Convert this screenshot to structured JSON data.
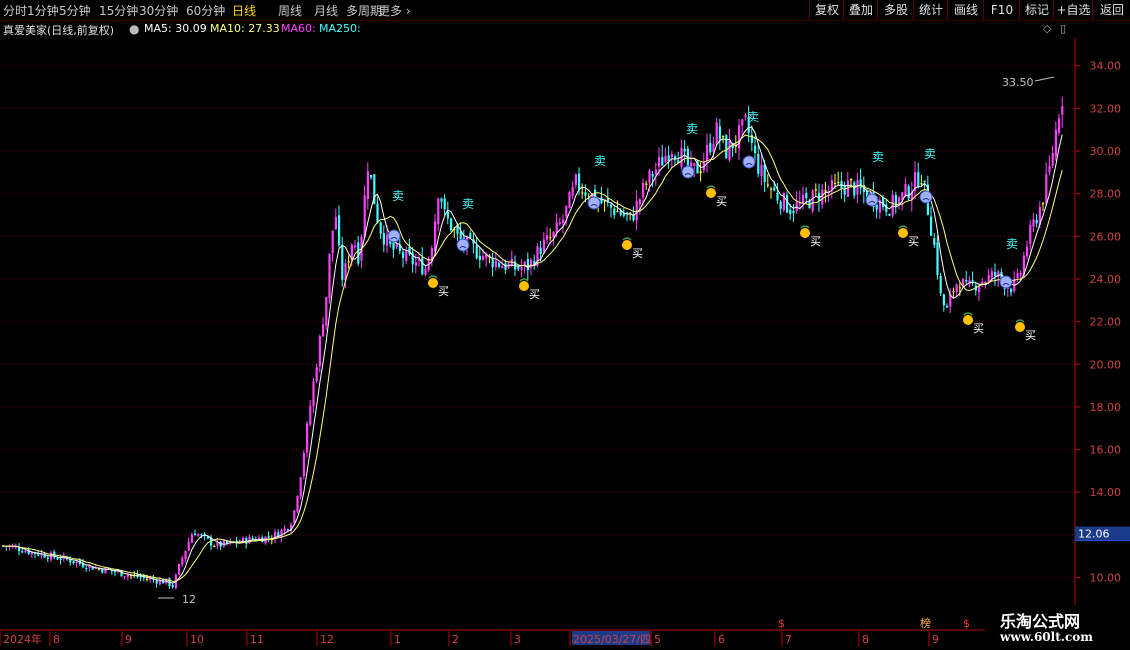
{
  "toolbar": {
    "periods": [
      "分时",
      "1分钟",
      "5分钟",
      "15分钟",
      "30分钟",
      "60分钟",
      "日线",
      "周线",
      "月线",
      "多周期",
      "更多"
    ],
    "active_index": 6,
    "right_buttons": [
      "复权",
      "叠加",
      "多股",
      "统计",
      "画线",
      "F10",
      "标记",
      "+自选",
      "返回"
    ]
  },
  "info": {
    "stock": "真爱美家(日线,前复权)",
    "ma5": "MA5: 30.09",
    "ma10": "MA10: 27.33",
    "ma60": "MA60:",
    "ma250": "MA250:"
  },
  "colors": {
    "up": "#ff40ff",
    "down": "#40ffff",
    "flat": "#ffff40",
    "ma5": "#ffffff",
    "ma10": "#ffff80",
    "grid": "#5a0000",
    "axis": "#c00000"
  },
  "chart_data": {
    "type": "candlestick",
    "ylim": [
      9.2,
      35.0
    ],
    "y_ticks": [
      10,
      12,
      14,
      16,
      18,
      20,
      22,
      24,
      26,
      28,
      30,
      32,
      34
    ],
    "y_tick_labels": [
      "10.00",
      "12.00",
      "14.00",
      "16.00",
      "18.00",
      "20.00",
      "22.00",
      "24.00",
      "26.00",
      "28.00",
      "30.00",
      "32.00",
      "34.00"
    ],
    "x_labels": [
      "2024年",
      "8",
      "9",
      "10",
      "11",
      "12",
      "1",
      "2",
      "3",
      "2025/03/27/四",
      "5",
      "6",
      "7",
      "8",
      "9"
    ],
    "last_price": "12.06",
    "price_path": [
      [
        0,
        11.5
      ],
      [
        15,
        11.4
      ],
      [
        30,
        11.2
      ],
      [
        50,
        11.0
      ],
      [
        70,
        10.8
      ],
      [
        90,
        10.5
      ],
      [
        110,
        10.3
      ],
      [
        130,
        10.1
      ],
      [
        150,
        9.9
      ],
      [
        165,
        9.8
      ],
      [
        172,
        9.6
      ],
      [
        176,
        10.2
      ],
      [
        180,
        10.8
      ],
      [
        186,
        11.5
      ],
      [
        192,
        12.2
      ],
      [
        200,
        11.9
      ],
      [
        215,
        11.5
      ],
      [
        230,
        11.6
      ],
      [
        250,
        11.8
      ],
      [
        270,
        11.9
      ],
      [
        285,
        12.3
      ],
      [
        292,
        12.8
      ],
      [
        300,
        15.0
      ],
      [
        306,
        17.0
      ],
      [
        312,
        19.0
      ],
      [
        320,
        21.5
      ],
      [
        326,
        23.5
      ],
      [
        330,
        26.0
      ],
      [
        335,
        27.0
      ],
      [
        340,
        24.0
      ],
      [
        345,
        24.5
      ],
      [
        352,
        26.0
      ],
      [
        358,
        25.0
      ],
      [
        362,
        27.0
      ],
      [
        367,
        29.5
      ],
      [
        372,
        28.0
      ],
      [
        378,
        26.5
      ],
      [
        388,
        25.5
      ],
      [
        398,
        25.2
      ],
      [
        412,
        24.8
      ],
      [
        425,
        24.5
      ],
      [
        432,
        26.0
      ],
      [
        438,
        28.5
      ],
      [
        443,
        27.0
      ],
      [
        450,
        26.5
      ],
      [
        458,
        25.8
      ],
      [
        470,
        25.5
      ],
      [
        485,
        25.0
      ],
      [
        500,
        24.7
      ],
      [
        515,
        24.5
      ],
      [
        528,
        24.6
      ],
      [
        540,
        25.5
      ],
      [
        552,
        26.0
      ],
      [
        562,
        26.8
      ],
      [
        575,
        28.5
      ],
      [
        588,
        28.0
      ],
      [
        600,
        27.6
      ],
      [
        615,
        27.2
      ],
      [
        630,
        26.8
      ],
      [
        645,
        28.5
      ],
      [
        660,
        29.5
      ],
      [
        670,
        30.2
      ],
      [
        680,
        29.8
      ],
      [
        690,
        29.0
      ],
      [
        700,
        29.3
      ],
      [
        715,
        31.0
      ],
      [
        725,
        30.0
      ],
      [
        735,
        30.5
      ],
      [
        745,
        31.3
      ],
      [
        755,
        29.5
      ],
      [
        765,
        28.5
      ],
      [
        778,
        27.8
      ],
      [
        790,
        27.3
      ],
      [
        805,
        27.6
      ],
      [
        818,
        28.0
      ],
      [
        832,
        28.2
      ],
      [
        848,
        28.4
      ],
      [
        860,
        28.1
      ],
      [
        875,
        27.7
      ],
      [
        888,
        27.4
      ],
      [
        900,
        27.8
      ],
      [
        912,
        28.4
      ],
      [
        920,
        29.0
      ],
      [
        928,
        27.0
      ],
      [
        935,
        25.0
      ],
      [
        940,
        23.0
      ],
      [
        946,
        22.5
      ],
      [
        952,
        23.5
      ],
      [
        958,
        24.0
      ],
      [
        965,
        23.5
      ],
      [
        975,
        23.8
      ],
      [
        985,
        24.0
      ],
      [
        995,
        24.2
      ],
      [
        1005,
        23.8
      ],
      [
        1012,
        23.6
      ],
      [
        1018,
        24.0
      ],
      [
        1025,
        25.5
      ],
      [
        1032,
        26.5
      ],
      [
        1040,
        27.5
      ],
      [
        1048,
        29.0
      ],
      [
        1055,
        31.0
      ],
      [
        1060,
        32.5
      ]
    ],
    "signals": {
      "buy": [
        [
          433,
          283
        ],
        [
          524,
          286
        ],
        [
          627,
          245
        ],
        [
          711,
          193
        ],
        [
          805,
          233
        ],
        [
          903,
          233
        ],
        [
          968,
          320
        ],
        [
          1020,
          327
        ]
      ],
      "sell": [
        [
          398,
          200
        ],
        [
          468,
          208
        ],
        [
          600,
          165
        ],
        [
          692,
          133
        ],
        [
          753,
          121
        ],
        [
          878,
          161
        ],
        [
          930,
          158
        ],
        [
          1012,
          248
        ]
      ],
      "face": [
        [
          394,
          236
        ],
        [
          463,
          245
        ],
        [
          594,
          203
        ],
        [
          688,
          172
        ],
        [
          749,
          162
        ],
        [
          872,
          200
        ],
        [
          926,
          197
        ],
        [
          1006,
          282
        ]
      ],
      "buy_label": "买",
      "sell_label": "卖"
    },
    "annotations": [
      {
        "text": "33.50",
        "x": 1002,
        "y": 76
      },
      {
        "text": "12",
        "x": 182,
        "y": 593
      }
    ]
  },
  "bottom_markers": [
    {
      "text": "$",
      "x": 778
    },
    {
      "text": "榜",
      "x": 920
    },
    {
      "text": "$",
      "x": 963
    }
  ],
  "logo": {
    "cn": "乐淘公式网",
    "url": "www.60lt.com"
  }
}
